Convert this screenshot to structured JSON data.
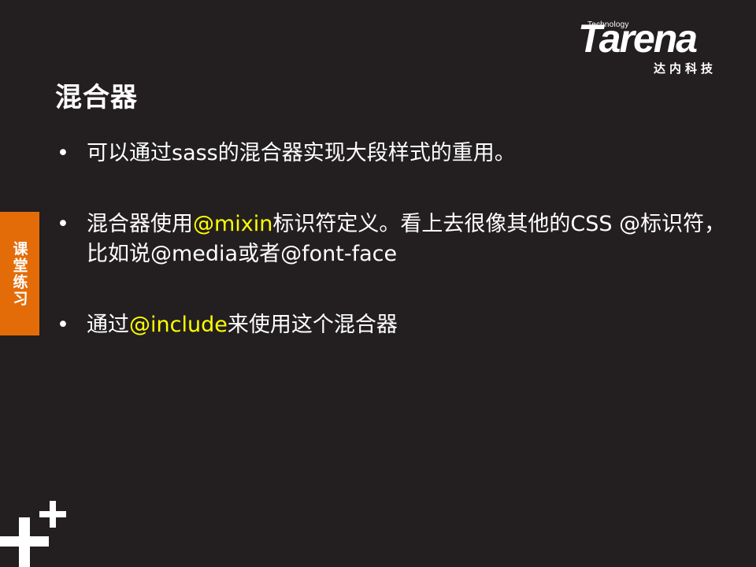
{
  "logo": {
    "tagline": "Technology",
    "wordmark": "Tarena",
    "chinese": "达内科技"
  },
  "slide": {
    "title": "混合器",
    "bullets": [
      {
        "segments": [
          {
            "text": "可以通过sass的混合器实现大段样式的重用。",
            "highlight": false
          }
        ]
      },
      {
        "segments": [
          {
            "text": "混合器使用",
            "highlight": false
          },
          {
            "text": "@mixin",
            "highlight": true
          },
          {
            "text": "标识符定义。看上去很像其他的CSS @标识符，比如说@media或者@font-face",
            "highlight": false
          }
        ]
      },
      {
        "segments": [
          {
            "text": "通过",
            "highlight": false
          },
          {
            "text": "@include",
            "highlight": true
          },
          {
            "text": "来使用这个混合器",
            "highlight": false
          }
        ]
      }
    ]
  },
  "side_tab": {
    "label": "课堂练习"
  },
  "colors": {
    "background": "#231f20",
    "text": "#ffffff",
    "highlight": "#ffff00",
    "tab": "#e36c09"
  },
  "icons": {
    "bottom_left": "plus-icon"
  }
}
